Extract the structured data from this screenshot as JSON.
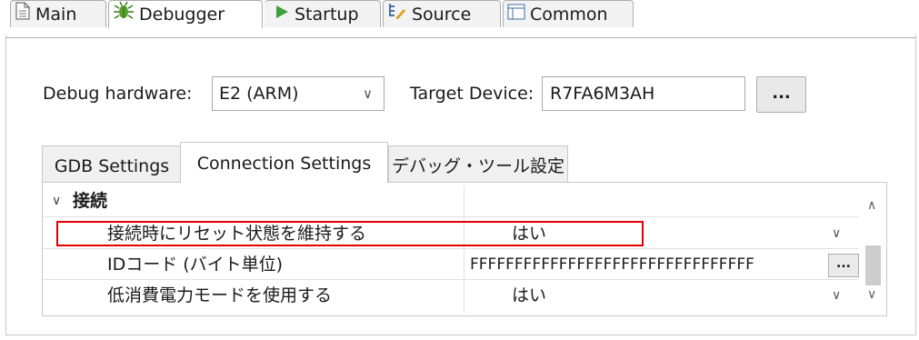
{
  "top_tabs": [
    {
      "label": "Main",
      "icon": "document-icon"
    },
    {
      "label": "Debugger",
      "icon": "bug-icon"
    },
    {
      "label": "Startup",
      "icon": "play-icon"
    },
    {
      "label": "Source",
      "icon": "source-icon"
    },
    {
      "label": "Common",
      "icon": "common-icon"
    }
  ],
  "debug_hw": {
    "label": "Debug hardware:",
    "value": "E2 (ARM)"
  },
  "target_device": {
    "label": "Target Device:",
    "value": "R7FA6M3AH",
    "browse_label": "..."
  },
  "inner_tabs": [
    "GDB Settings",
    "Connection Settings",
    "デバッグ・ツール設定"
  ],
  "tree": {
    "group": "接続",
    "rows": [
      {
        "name": "接続時にリセット状態を維持する",
        "value": "はい"
      },
      {
        "name": "IDコード (バイト単位)",
        "value": "FFFFFFFFFFFFFFFFFFFFFFFFFFFFFFFF",
        "button": "..."
      },
      {
        "name": "低消費電力モードを使用する",
        "value": "はい"
      }
    ]
  },
  "colors": {
    "highlight": "#e00000",
    "accent_green": "#3ca03c"
  }
}
